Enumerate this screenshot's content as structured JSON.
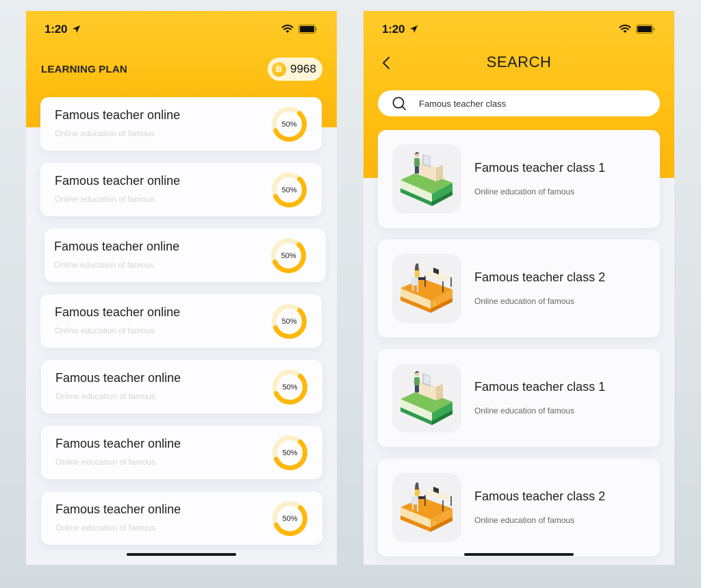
{
  "status_bar": {
    "time": "1:20"
  },
  "learning_plan": {
    "title": "LEARNING PLAN",
    "coin_letter": "B",
    "coin_count": "9968",
    "accent_color": "#ffb70a",
    "items": [
      {
        "title": "Famous teacher online",
        "subtitle": "Online education of famous",
        "progress_label": "50%",
        "progress": 0.5
      },
      {
        "title": "Famous teacher online",
        "subtitle": "Online education of famous",
        "progress_label": "50%",
        "progress": 0.5
      },
      {
        "title": "Famous teacher online",
        "subtitle": "Online education of famous",
        "progress_label": "50%",
        "progress": 0.5
      },
      {
        "title": "Famous teacher online",
        "subtitle": "Online education of famous",
        "progress_label": "50%",
        "progress": 0.5
      },
      {
        "title": "Famous teacher online",
        "subtitle": "Online education of famous",
        "progress_label": "50%",
        "progress": 0.5
      },
      {
        "title": "Famous teacher online",
        "subtitle": "Online education of famous",
        "progress_label": "50%",
        "progress": 0.5
      },
      {
        "title": "Famous teacher online",
        "subtitle": "Online education of famous",
        "progress_label": "50%",
        "progress": 0.5
      }
    ]
  },
  "search": {
    "title": "SEARCH",
    "query": "Famous teacher class",
    "results": [
      {
        "title": "Famous teacher class 1",
        "subtitle": "Online education of famous",
        "thumbnail": "green-book-desk-illustration"
      },
      {
        "title": "Famous teacher class 2",
        "subtitle": "Online education of famous",
        "thumbnail": "orange-book-desk-illustration"
      },
      {
        "title": "Famous teacher class 1",
        "subtitle": "Online education of famous",
        "thumbnail": "green-book-desk-illustration"
      },
      {
        "title": "Famous teacher class 2",
        "subtitle": "Online education of famous",
        "thumbnail": "orange-book-desk-illustration"
      }
    ]
  }
}
